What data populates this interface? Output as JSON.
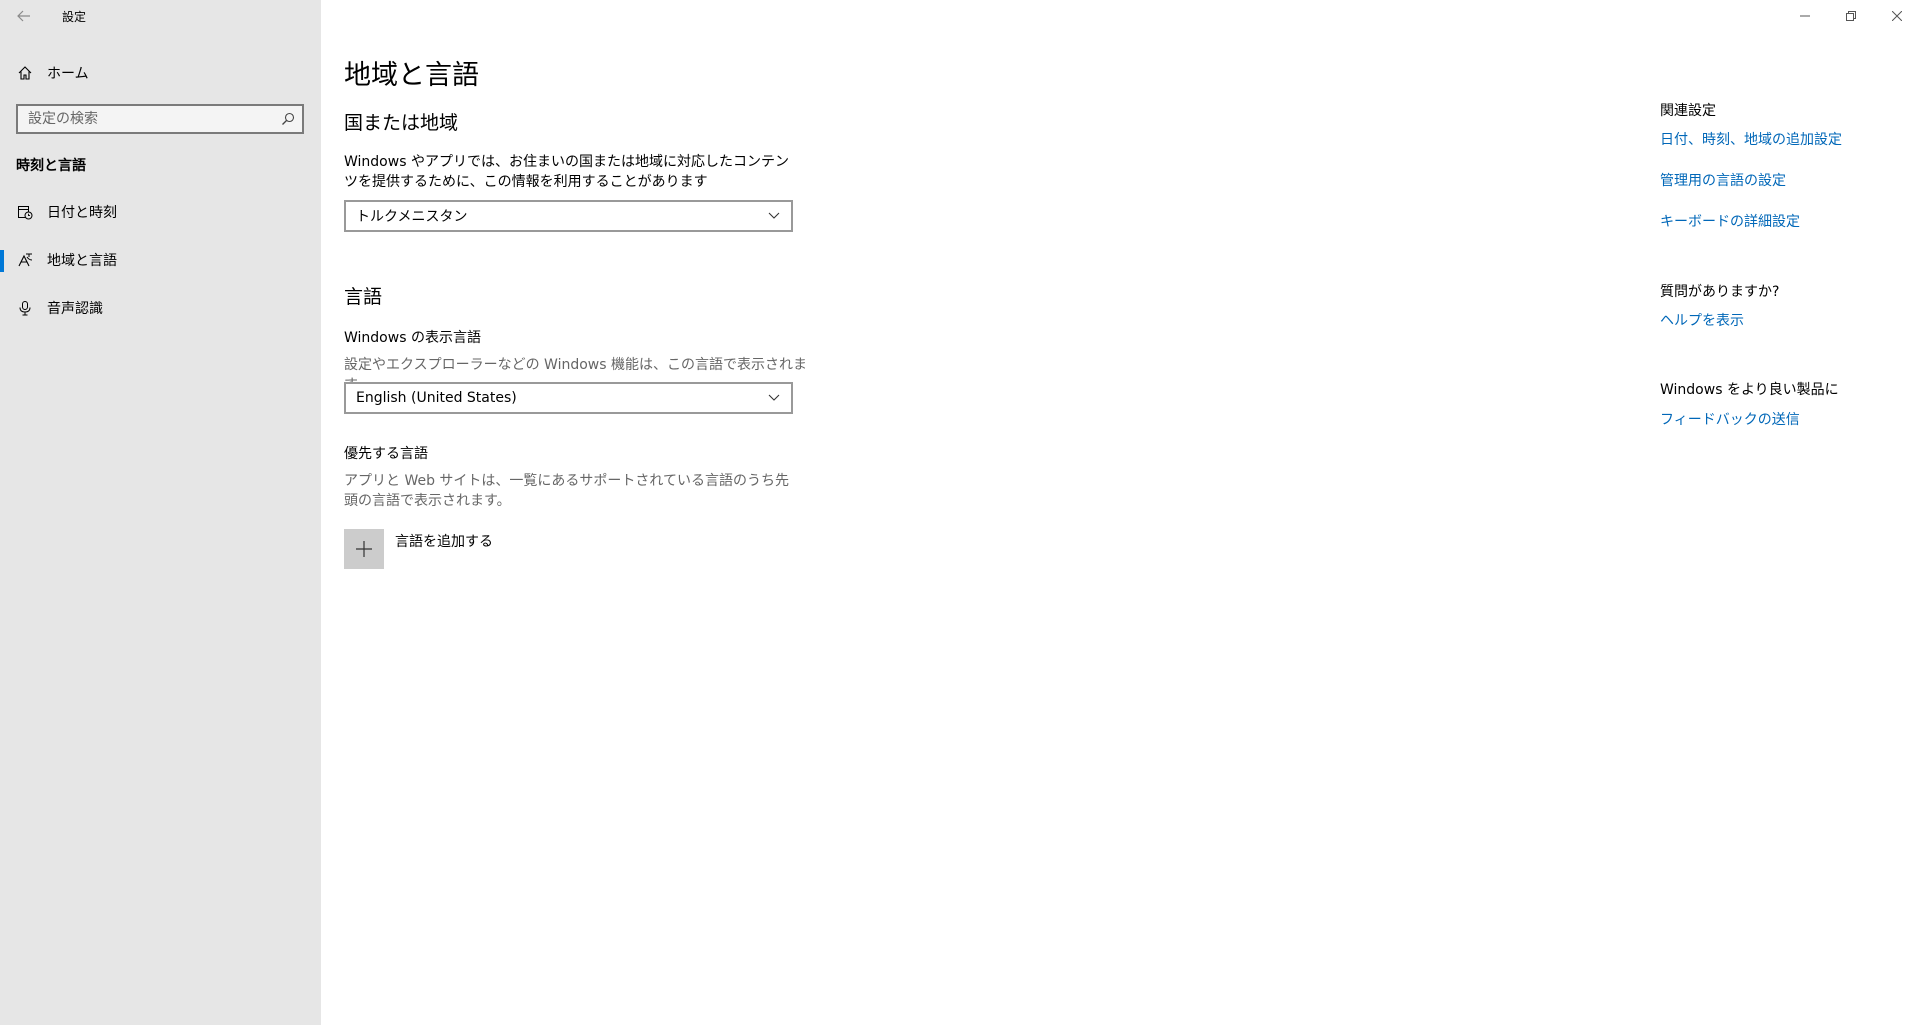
{
  "window": {
    "app_title": "設定",
    "minimize_glyph": "—",
    "restore_glyph": "❐",
    "close_glyph": "✕"
  },
  "sidebar": {
    "home_label": "ホーム",
    "search_placeholder": "設定の検索",
    "section_title": "時刻と言語",
    "items": [
      {
        "label": "日付と時刻",
        "icon": "calendar-clock-icon"
      },
      {
        "label": "地域と言語",
        "icon": "region-language-icon",
        "selected": true
      },
      {
        "label": "音声認識",
        "icon": "microphone-icon"
      }
    ]
  },
  "main": {
    "page_title": "地域と言語",
    "region": {
      "heading": "国または地域",
      "description": "Windows やアプリでは、お住まいの国または地域に対応したコンテンツを提供するために、この情報を利用することがあります",
      "selected": "トルクメニスタン"
    },
    "language": {
      "heading": "言語",
      "display_lang_title": "Windows の表示言語",
      "display_lang_desc": "設定やエクスプローラーなどの Windows 機能は、この言語で表示されます。",
      "display_lang_selected": "English (United States)",
      "preferred_title": "優先する言語",
      "preferred_desc": "アプリと Web サイトは、一覧にあるサポートされている言語のうち先頭の言語で表示されます。",
      "add_label": "言語を追加する"
    }
  },
  "related": {
    "title": "関連設定",
    "links": [
      "日付、時刻、地域の追加設定",
      "管理用の言語の設定",
      "キーボードの詳細設定"
    ],
    "question_title": "質問がありますか?",
    "help_link": "ヘルプを表示",
    "improve_title": "Windows をより良い製品に",
    "feedback_link": "フィードバックの送信"
  },
  "colors": {
    "accent": "#0078d7",
    "link": "#0067b8",
    "sidebar_bg": "#e6e6e6"
  }
}
